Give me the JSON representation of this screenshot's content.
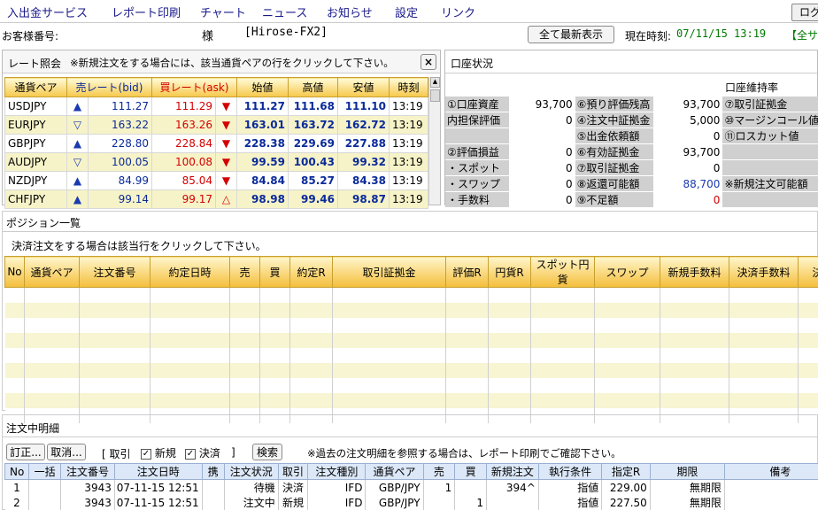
{
  "menu": [
    "入出金サービス",
    "レポート印刷",
    "チャート",
    "ニュース",
    "お知らせ",
    "設定",
    "リンク"
  ],
  "exit_label": "ログ",
  "header": {
    "customer_label": "お客様番号:",
    "sama": "様",
    "system": "[Hirose-FX2]",
    "refresh_button": "全て最新表示",
    "time_label": "現在時刻:",
    "time_value": "07/11/15 13:19",
    "extra": "【全サ"
  },
  "rates": {
    "title": "レート照会",
    "note": "※新規注文をする場合には、該当通貨ペアの行をクリックして下さい。",
    "close": "×",
    "columns": [
      "通貨ペア",
      "売レート(bid)",
      "買レート(ask)",
      "始値",
      "高値",
      "安値",
      "時刻"
    ],
    "rows": [
      {
        "pair": "USDJPY",
        "bid_dir": "up",
        "bid": "111.27",
        "ask": "111.29",
        "ask_dir": "down",
        "open": "111.27",
        "high": "111.68",
        "low": "111.10",
        "time": "13:19"
      },
      {
        "pair": "EURJPY",
        "bid_dir": "down-open",
        "bid": "163.22",
        "ask": "163.26",
        "ask_dir": "down",
        "open": "163.01",
        "high": "163.72",
        "low": "162.72",
        "time": "13:19"
      },
      {
        "pair": "GBPJPY",
        "bid_dir": "up",
        "bid": "228.80",
        "ask": "228.84",
        "ask_dir": "down",
        "open": "228.38",
        "high": "229.69",
        "low": "227.88",
        "time": "13:19"
      },
      {
        "pair": "AUDJPY",
        "bid_dir": "down-open",
        "bid": "100.05",
        "ask": "100.08",
        "ask_dir": "down",
        "open": "99.59",
        "high": "100.43",
        "low": "99.32",
        "time": "13:19"
      },
      {
        "pair": "NZDJPY",
        "bid_dir": "up",
        "bid": "84.99",
        "ask": "85.04",
        "ask_dir": "down",
        "open": "84.84",
        "high": "85.27",
        "low": "84.38",
        "time": "13:19"
      },
      {
        "pair": "CHFJPY",
        "bid_dir": "up",
        "bid": "99.14",
        "ask": "99.17",
        "ask_dir": "up-open",
        "open": "98.98",
        "high": "99.46",
        "low": "98.87",
        "time": "13:19"
      }
    ]
  },
  "account": {
    "title": "口座状況",
    "maint_label": "口座維持率",
    "rows": [
      [
        "①口座資産",
        "93,700",
        "⑥預り評価残高",
        "93,700",
        "⑦取引証拠金"
      ],
      [
        "内担保評価",
        "0",
        "④注文中証拠金",
        "5,000",
        "⑩マージンコール値"
      ],
      [
        "",
        "",
        "⑤出金依頼額",
        "0",
        "⑪ロスカット値"
      ],
      [
        "②評価損益",
        "0",
        "⑥有効証拠金",
        "93,700",
        ""
      ],
      [
        "・スポット",
        "0",
        "⑦取引証拠金",
        "0",
        ""
      ],
      [
        "・スワップ",
        "0",
        "⑧返還可能額",
        "88,700",
        "※新規注文可能額"
      ],
      [
        "・手数料",
        "0",
        "⑨不足額",
        "0",
        ""
      ]
    ]
  },
  "positions": {
    "title": "ポジション一覧",
    "note": "決済注文をする場合は該当行をクリックして下さい。",
    "columns": [
      "No",
      "通貨ペア",
      "注文番号",
      "約定日時",
      "売",
      "買",
      "約定R",
      "取引証拠金",
      "評価R",
      "円貨R",
      "スポット円貨",
      "スワップ",
      "新規手数料",
      "決済手数料",
      "決"
    ]
  },
  "orders": {
    "title": "注文中明細",
    "btn_correct": "訂正...",
    "btn_cancel": "取消...",
    "filter_prefix": "[ 取引",
    "chk_new": "新規",
    "chk_settle": "決済",
    "filter_suffix": "]",
    "search": "検索",
    "note": "※過去の注文明細を参照する場合は、レポート印刷でご確認下さい。",
    "columns": [
      "No",
      "一括",
      "注文番号",
      "注文日時",
      "携",
      "注文状況",
      "取引",
      "注文種別",
      "通貨ペア",
      "売",
      "買",
      "新規注文",
      "執行条件",
      "指定R",
      "期限",
      "備考"
    ],
    "rows": [
      [
        "1",
        "",
        "3943",
        "07-11-15 12:51",
        "",
        "待機",
        "決済",
        "IFD",
        "GBP/JPY",
        "1",
        "",
        "394^",
        "指値",
        "229.00",
        "無期限",
        ""
      ],
      [
        "2",
        "",
        "3943",
        "07-11-15 12:51",
        "",
        "注文中",
        "新規",
        "IFD",
        "GBP/JPY",
        "",
        "1",
        "",
        "指値",
        "227.50",
        "無期限",
        ""
      ]
    ]
  }
}
